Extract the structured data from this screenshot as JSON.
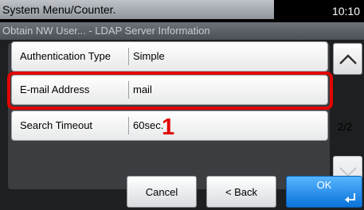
{
  "header": {
    "title": "System Menu/Counter.",
    "time": "10:10",
    "subtitle": "Obtain NW User... - LDAP Server Information"
  },
  "settings": [
    {
      "label": "Authentication Type",
      "value": "Simple"
    },
    {
      "label": "E-mail Address",
      "value": "mail"
    },
    {
      "label": "Search Timeout",
      "value": "60sec."
    }
  ],
  "pagination": {
    "indicator": "2/2"
  },
  "callout": {
    "number": "1"
  },
  "buttons": {
    "cancel": "Cancel",
    "back": "< Back",
    "ok": "OK"
  },
  "colors": {
    "highlight": "#e10600",
    "ok_button": "#1e8cf0"
  }
}
